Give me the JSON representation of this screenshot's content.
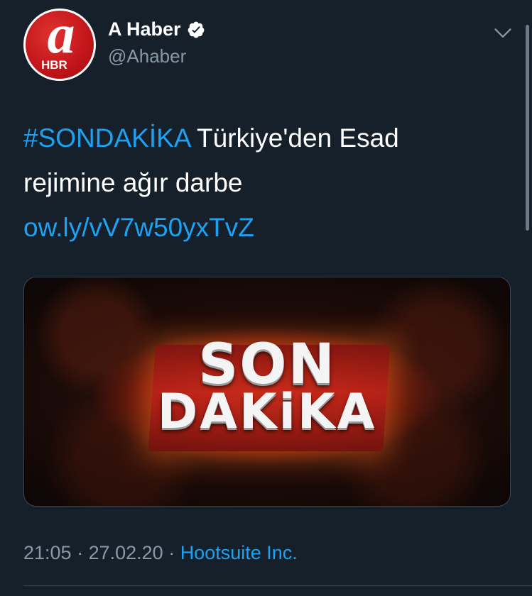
{
  "account": {
    "display_name": "A Haber",
    "handle": "@Ahaber",
    "verified": true,
    "avatar_letter": "a",
    "avatar_text": "HBR"
  },
  "icons": {
    "verified": "verified-badge-icon",
    "menu": "chevron-down-icon"
  },
  "tweet": {
    "hashtag": "#SONDAKİKA",
    "text": " Türkiye'den Esad rejimine ağır darbe ",
    "link": "ow.ly/vV7w50yxTvZ"
  },
  "media": {
    "line1": "SON",
    "line2": "DAKiKA"
  },
  "meta": {
    "time": "21:05",
    "separator1": " · ",
    "date": "27.02.20",
    "separator2": " · ",
    "source": "Hootsuite Inc."
  },
  "colors": {
    "background": "#15202b",
    "link": "#1da1f2",
    "secondary_text": "#8899a6"
  }
}
